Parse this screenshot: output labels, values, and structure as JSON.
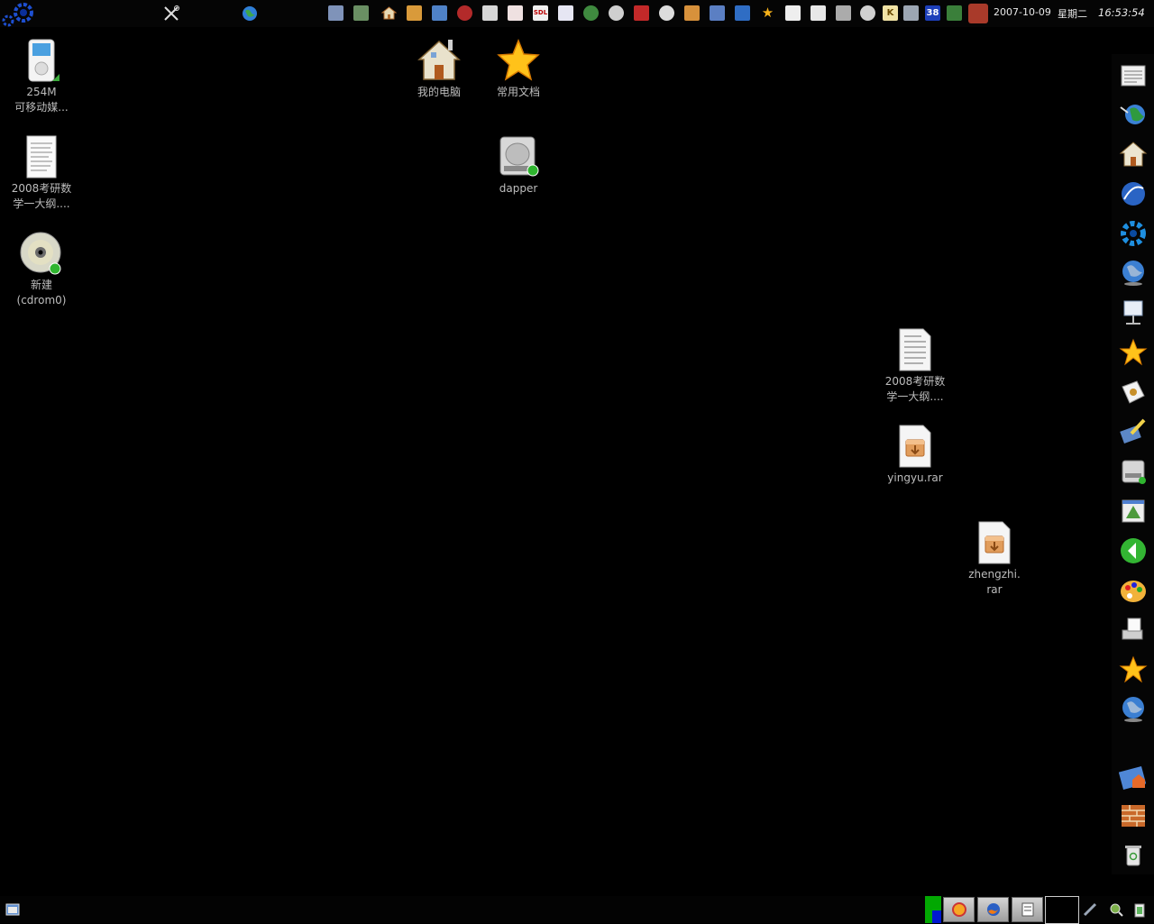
{
  "top_panel": {
    "clock": {
      "date": "2007-10-09",
      "weekday": "星期二",
      "time": "16:53:54"
    },
    "tray_badge": "38",
    "tray_k": "K",
    "tray_sdl": "SDL"
  },
  "desktop": {
    "icons": [
      {
        "id": "ipod",
        "label": "254M\n可移动媒..."
      },
      {
        "id": "pdf-doc-left",
        "label": "2008考研数\n学一大纲...."
      },
      {
        "id": "cdrom",
        "label": "新建\n(cdrom0)"
      },
      {
        "id": "my-computer",
        "label": "我的电脑"
      },
      {
        "id": "favorites",
        "label": "常用文档"
      },
      {
        "id": "dapper-drive",
        "label": "dapper"
      },
      {
        "id": "pdf-doc-right",
        "label": "2008考研数\n学一大纲...."
      },
      {
        "id": "yingyu-rar",
        "label": "yingyu.rar"
      },
      {
        "id": "zhengzhi-rar",
        "label": "zhengzhi.\nrar"
      }
    ]
  },
  "colors": {
    "background": "#000000",
    "panel": "#050505",
    "label_text": "#bdbdbd",
    "clock_text": "#e8e8e8"
  }
}
